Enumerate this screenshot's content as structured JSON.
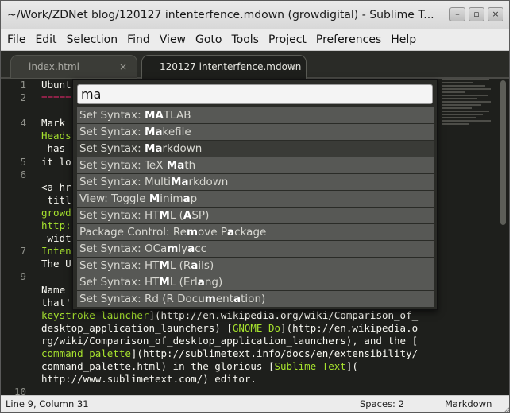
{
  "window": {
    "title": "~/Work/ZDNet blog/120127 intenterfence.mdown (growdigital) - Sublime T...",
    "controls": [
      "–",
      "▫",
      "×"
    ]
  },
  "menu": [
    "File",
    "Edit",
    "Selection",
    "Find",
    "View",
    "Goto",
    "Tools",
    "Project",
    "Preferences",
    "Help"
  ],
  "tabs": [
    {
      "label": "index.html",
      "active": false,
      "close": "×"
    },
    {
      "label": "120127 intenterfence.mdown",
      "active": true,
      "close": "×"
    }
  ],
  "gutter": [
    "1",
    "2",
    "",
    "4",
    "",
    "",
    "5",
    "6",
    "",
    "",
    "",
    "",
    "",
    "7",
    "",
    "9",
    "",
    "",
    "",
    "",
    "",
    "",
    "",
    "",
    "10"
  ],
  "code_lines": [
    {
      "segments": [
        {
          "t": "Ubunt"
        }
      ]
    },
    {
      "segments": [
        {
          "t": "=====",
          "c": "red"
        }
      ]
    },
    {
      "segments": [
        {
          "t": ""
        }
      ]
    },
    {
      "segments": [
        {
          "t": "Mark "
        }
      ]
    },
    {
      "segments": [
        {
          "t": "Heads",
          "c": "green"
        }
      ]
    },
    {
      "segments": [
        {
          "t": " has "
        }
      ]
    },
    {
      "segments": [
        {
          "t": "it lo"
        }
      ]
    },
    {
      "segments": [
        {
          "t": ""
        }
      ]
    },
    {
      "segments": [
        {
          "t": "<a hr"
        }
      ]
    },
    {
      "segments": [
        {
          "t": " titl"
        }
      ]
    },
    {
      "segments": [
        {
          "t": "growd",
          "c": "green"
        }
      ]
    },
    {
      "segments": [
        {
          "t": "http:",
          "c": "green"
        }
      ]
    },
    {
      "segments": [
        {
          "t": " widt"
        }
      ]
    },
    {
      "segments": [
        {
          "t": "Inten",
          "c": "green"
        }
      ]
    },
    {
      "segments": [
        {
          "t": "The U"
        }
      ]
    },
    {
      "segments": [
        {
          "t": ""
        }
      ]
    },
    {
      "segments": [
        {
          "t": "Name "
        }
      ]
    },
    {
      "segments": [
        {
          "t": "that'"
        }
      ]
    },
    {
      "segments": [
        {
          "t": "keystroke launcher",
          "c": "green"
        },
        {
          "t": "](http://en.wikipedia.org/wiki/Comparison_of_"
        }
      ]
    },
    {
      "segments": [
        {
          "t": "desktop_application_launchers) ["
        },
        {
          "t": "GNOME Do",
          "c": "green"
        },
        {
          "t": "](http://en.wikipedia.o"
        }
      ]
    },
    {
      "segments": [
        {
          "t": "rg/wiki/Comparison_of_desktop_application_launchers), and the ["
        }
      ]
    },
    {
      "segments": [
        {
          "t": "command palette",
          "c": "green"
        },
        {
          "t": "](http://sublimetext.info/docs/en/extensibility/"
        }
      ]
    },
    {
      "segments": [
        {
          "t": "command_palette.html) in the glorious ["
        },
        {
          "t": "Sublime Text",
          "c": "green"
        },
        {
          "t": "]("
        }
      ]
    },
    {
      "segments": [
        {
          "t": "http://www.sublimetext.com/) editor."
        }
      ]
    },
    {
      "segments": [
        {
          "t": ""
        }
      ]
    }
  ],
  "right_fragments": [
    {
      "line": 4,
      "text": ")"
    },
    {
      "line": 8,
      "text": "\""
    },
    {
      "line": 12,
      "text": "\""
    }
  ],
  "palette": {
    "query": "ma",
    "items": [
      {
        "parts": [
          {
            "t": "Set Syntax: "
          },
          {
            "t": "MA",
            "b": true
          },
          {
            "t": "TLAB"
          }
        ]
      },
      {
        "parts": [
          {
            "t": "Set Syntax: "
          },
          {
            "t": "Ma",
            "b": true
          },
          {
            "t": "kefile"
          }
        ]
      },
      {
        "parts": [
          {
            "t": "Set Syntax: "
          },
          {
            "t": "Ma",
            "b": true
          },
          {
            "t": "rkdown"
          }
        ],
        "selected": true
      },
      {
        "parts": [
          {
            "t": "Set Syntax: TeX "
          },
          {
            "t": "Ma",
            "b": true
          },
          {
            "t": "th"
          }
        ]
      },
      {
        "parts": [
          {
            "t": "Set Syntax: Multi"
          },
          {
            "t": "Ma",
            "b": true
          },
          {
            "t": "rkdown"
          }
        ]
      },
      {
        "parts": [
          {
            "t": "View: Toggle "
          },
          {
            "t": "M",
            "b": true
          },
          {
            "t": "inim"
          },
          {
            "t": "a",
            "b": true
          },
          {
            "t": "p"
          }
        ]
      },
      {
        "parts": [
          {
            "t": "Set Syntax: HT"
          },
          {
            "t": "M",
            "b": true
          },
          {
            "t": "L ("
          },
          {
            "t": "A",
            "b": true
          },
          {
            "t": "SP)"
          }
        ]
      },
      {
        "parts": [
          {
            "t": "Package Control: Re"
          },
          {
            "t": "m",
            "b": true
          },
          {
            "t": "ove P"
          },
          {
            "t": "a",
            "b": true
          },
          {
            "t": "ckage"
          }
        ]
      },
      {
        "parts": [
          {
            "t": "Set Syntax: OCa"
          },
          {
            "t": "m",
            "b": true
          },
          {
            "t": "ly"
          },
          {
            "t": "a",
            "b": true
          },
          {
            "t": "cc"
          }
        ]
      },
      {
        "parts": [
          {
            "t": "Set Syntax: HT"
          },
          {
            "t": "M",
            "b": true
          },
          {
            "t": "L (R"
          },
          {
            "t": "a",
            "b": true
          },
          {
            "t": "ils)"
          }
        ]
      },
      {
        "parts": [
          {
            "t": "Set Syntax: HT"
          },
          {
            "t": "M",
            "b": true
          },
          {
            "t": "L (Erl"
          },
          {
            "t": "a",
            "b": true
          },
          {
            "t": "ng)"
          }
        ]
      },
      {
        "parts": [
          {
            "t": "Set Syntax: Rd (R Docu"
          },
          {
            "t": "m",
            "b": true
          },
          {
            "t": "ent"
          },
          {
            "t": "a",
            "b": true
          },
          {
            "t": "tion)"
          }
        ]
      }
    ]
  },
  "status": {
    "position": "Line 9, Column 31",
    "spaces": "Spaces: 2",
    "syntax": "Markdown"
  },
  "colors": {
    "editor_bg": "#1e1f1c",
    "string_green": "#a6e22e",
    "heading_red": "#f92672",
    "palette_item": "#575855",
    "palette_selected": "#3a3b37"
  }
}
